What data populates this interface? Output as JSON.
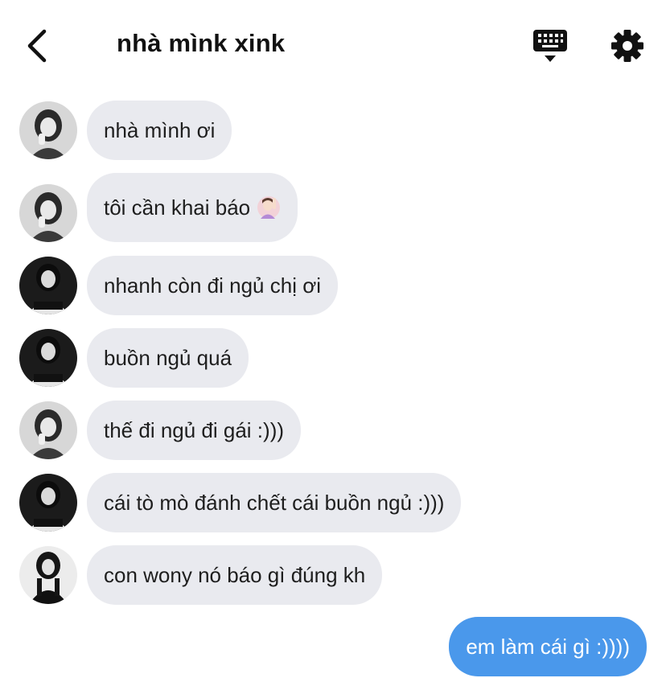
{
  "header": {
    "title": "nhà mìnk xink",
    "back_icon": "chevron-left-icon",
    "keyboard_icon": "keyboard-icon",
    "settings_icon": "gear-icon"
  },
  "colors": {
    "incoming_bubble": "#e9eaef",
    "outgoing_bubble": "#4a98eb",
    "outgoing_text": "#ffffff"
  },
  "messages": [
    {
      "direction": "in",
      "avatar": "avatar-girl-hands-face",
      "text": "nhà mình ơi"
    },
    {
      "direction": "in",
      "avatar": "avatar-girl-hands-face",
      "text": "tôi cần khai báo",
      "emoji": "person-raising-hand-emoji"
    },
    {
      "direction": "in",
      "avatar": "avatar-girl-dark-bg",
      "text": "nhanh còn đi ngủ chị ơi"
    },
    {
      "direction": "in",
      "avatar": "avatar-girl-dark-bg",
      "text": "buồn ngủ quá"
    },
    {
      "direction": "in",
      "avatar": "avatar-girl-hands-face",
      "text": "thế đi ngủ đi gái :)))"
    },
    {
      "direction": "in",
      "avatar": "avatar-girl-dark-bg",
      "text": "cái tò mò đánh chết cái buồn ngủ :)))"
    },
    {
      "direction": "in",
      "avatar": "avatar-girl-standing",
      "text": "con wony nó báo gì đúng kh"
    },
    {
      "direction": "out",
      "text": "em làm cái gì :))))"
    }
  ]
}
